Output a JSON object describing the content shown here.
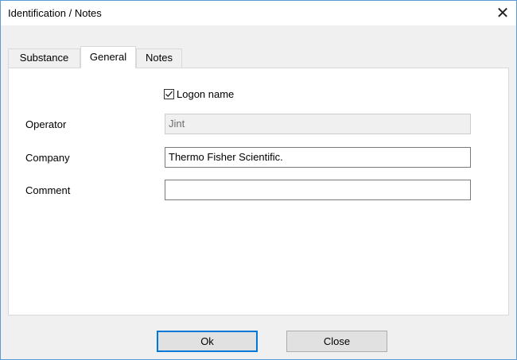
{
  "window": {
    "title": "Identification / Notes",
    "close_glyph": "✕",
    "accent_color": "#0078d7"
  },
  "tabs": [
    {
      "label": "Substance",
      "active": false
    },
    {
      "label": "General",
      "active": true
    },
    {
      "label": "Notes",
      "active": false
    }
  ],
  "general": {
    "logon_checkbox": {
      "label": "Logon name",
      "checked": true
    },
    "operator": {
      "label": "Operator",
      "value": "Jint",
      "disabled": true
    },
    "company": {
      "label": "Company",
      "value": "Thermo Fisher Scientific."
    },
    "comment": {
      "label": "Comment",
      "value": ""
    }
  },
  "buttons": {
    "ok_label": "Ok",
    "close_label": "Close"
  }
}
